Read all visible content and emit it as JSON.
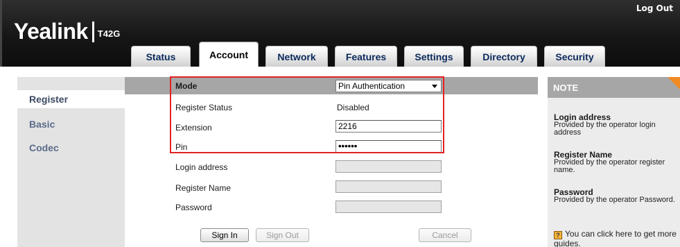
{
  "header": {
    "logout_label": "Log Out",
    "brand": "Yealink",
    "model": "T42G"
  },
  "tabs": [
    {
      "label": "Status"
    },
    {
      "label": "Account",
      "active": true
    },
    {
      "label": "Network"
    },
    {
      "label": "Features"
    },
    {
      "label": "Settings"
    },
    {
      "label": "Directory"
    },
    {
      "label": "Security"
    }
  ],
  "sidebar": {
    "items": [
      {
        "label": "Register",
        "active": true
      },
      {
        "label": "Basic"
      },
      {
        "label": "Codec"
      }
    ]
  },
  "form": {
    "mode": {
      "label": "Mode",
      "value": "Pin Authentication"
    },
    "register_status": {
      "label": "Register Status",
      "value": "Disabled"
    },
    "extension": {
      "label": "Extension",
      "value": "2216"
    },
    "pin": {
      "label": "Pin",
      "value": "••••••"
    },
    "login_address": {
      "label": "Login address",
      "value": ""
    },
    "register_name": {
      "label": "Register Name",
      "value": ""
    },
    "password": {
      "label": "Password",
      "value": ""
    }
  },
  "buttons": {
    "sign_in": "Sign In",
    "sign_out": "Sign Out",
    "cancel": "Cancel"
  },
  "note": {
    "title": "NOTE",
    "items": [
      {
        "title": "Login address",
        "text": "Provided by the operator login address"
      },
      {
        "title": "Register Name",
        "text": "Provided by the operator register name."
      },
      {
        "title": "Password",
        "text": "Provided by the operator Password."
      }
    ],
    "guide_icon": "?",
    "guide_text": "You can click here to get more guides."
  },
  "colors": {
    "highlight": "#e32222",
    "note_accent": "#f08a24",
    "header_bg": "#161616",
    "bar_gray": "#a6a6a6"
  }
}
